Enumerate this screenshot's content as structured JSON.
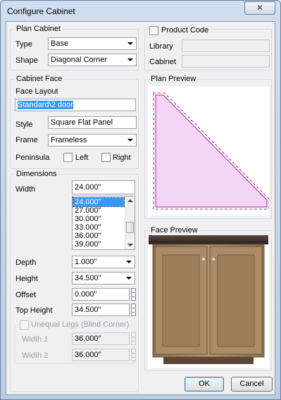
{
  "window": {
    "title": "Configure Cabinet",
    "close_glyph": "✕"
  },
  "plan_cabinet": {
    "title": "Plan Cabinet",
    "type_label": "Type",
    "type_value": "Base",
    "shape_label": "Shape",
    "shape_value": "Diagonal Corner"
  },
  "product_code": {
    "label": "Product Code",
    "checked": false,
    "library_label": "Library",
    "library_value": "",
    "cabinet_label": "Cabinet",
    "cabinet_value": ""
  },
  "cabinet_face": {
    "title": "Cabinet Face",
    "face_layout_label": "Face Layout",
    "face_layout_value": "Standard\\2 door",
    "style_label": "Style",
    "style_value": "Square Flat Panel",
    "frame_label": "Frame",
    "frame_value": "Frameless",
    "peninsula_label": "Peninsula",
    "left_label": "Left",
    "right_label": "Right"
  },
  "plan_preview": {
    "title": "Plan Preview",
    "fill_color": "#f3d6f3",
    "line_color": "#a0249b"
  },
  "dimensions": {
    "title": "Dimensions",
    "width_label": "Width",
    "width_value": "24.000\"",
    "width_options": [
      "24.000\"",
      "27.000\"",
      "30.000\"",
      "33.000\"",
      "36.000\"",
      "39.000\""
    ],
    "width_selected_index": 0,
    "depth_label": "Depth",
    "depth_value": "1.000\"",
    "height_label": "Height",
    "height_value": "34.500\"",
    "offset_label": "Offset",
    "offset_value": "0.000\"",
    "top_height_label": "Top Height",
    "top_height_value": "34.500\"",
    "unequal_legs_label": "Unequal Legs (Blind Corner)",
    "width1_label": "Width 1",
    "width1_value": "36.000\"",
    "width2_label": "Width 2",
    "width2_value": "36.000\""
  },
  "face_preview": {
    "title": "Face Preview",
    "wood_color": "#a88a66",
    "countertop_color": "#3a2c26"
  },
  "buttons": {
    "ok": "OK",
    "cancel": "Cancel"
  },
  "icons": [
    "close-icon",
    "chevron-down-icon",
    "spinner-icon",
    "scroll-up-icon",
    "scroll-down-icon"
  ]
}
